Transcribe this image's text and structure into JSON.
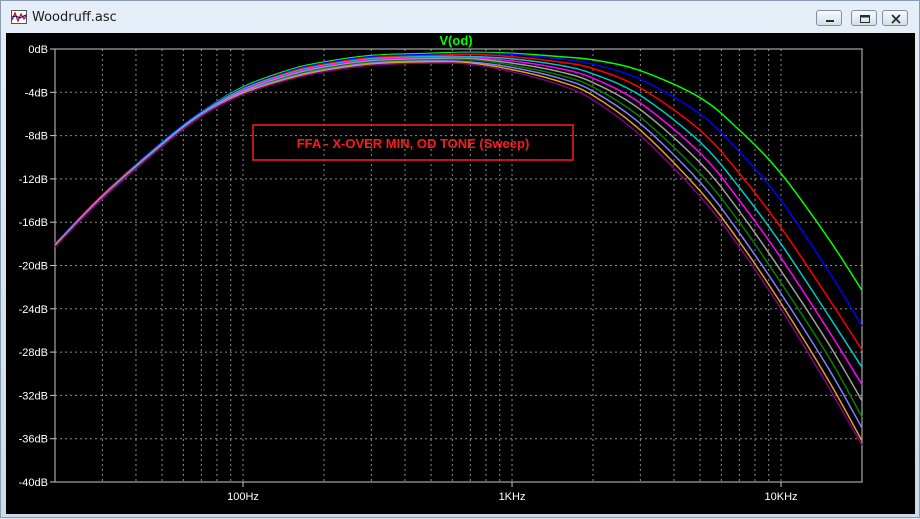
{
  "window": {
    "title": "Woodruff.asc",
    "icon": "ltspice-waveform-icon",
    "controls": [
      "minimize-icon",
      "restore-icon",
      "close-icon"
    ]
  },
  "colors": {
    "background": "#000000",
    "grid": "#8c8c8c",
    "axis": "#c8c8c8",
    "title": "#00ff00",
    "annotation": "#ff1a1a"
  },
  "chart_data": {
    "type": "line",
    "title": "V(od)",
    "annotation": "FFA - X-OVER MIN, OD TONE (Sweep)",
    "xscale": "log",
    "xlim": [
      20,
      20000
    ],
    "ylim": [
      -40,
      0
    ],
    "grid": true,
    "x_ticks": [
      {
        "value": 100,
        "label": "100Hz"
      },
      {
        "value": 1000,
        "label": "1KHz"
      },
      {
        "value": 10000,
        "label": "10KHz"
      }
    ],
    "y_ticks": [
      {
        "value": 0,
        "label": "0dB"
      },
      {
        "value": -4,
        "label": "-4dB"
      },
      {
        "value": -8,
        "label": "-8dB"
      },
      {
        "value": -12,
        "label": "-12dB"
      },
      {
        "value": -16,
        "label": "-16dB"
      },
      {
        "value": -20,
        "label": "-20dB"
      },
      {
        "value": -24,
        "label": "-24dB"
      },
      {
        "value": -28,
        "label": "-28dB"
      },
      {
        "value": -32,
        "label": "-32dB"
      },
      {
        "value": -36,
        "label": "-36dB"
      },
      {
        "value": -40,
        "label": "-40dB"
      }
    ],
    "x": [
      20,
      30,
      50,
      70,
      100,
      150,
      200,
      300,
      500,
      700,
      1000,
      1500,
      2000,
      3000,
      5000,
      7000,
      10000,
      15000,
      20000
    ],
    "series": [
      {
        "color": "#00ff00",
        "values": [
          -18.0,
          -13.5,
          -8.6,
          -5.8,
          -3.5,
          -1.9,
          -1.2,
          -0.6,
          -0.4,
          -0.3,
          -0.4,
          -0.7,
          -1.0,
          -2.0,
          -4.5,
          -7.5,
          -11.5,
          -17.5,
          -22.3
        ]
      },
      {
        "color": "#0000ff",
        "values": [
          -18.0,
          -13.5,
          -8.6,
          -5.8,
          -3.6,
          -2.0,
          -1.3,
          -0.7,
          -0.5,
          -0.4,
          -0.5,
          -0.9,
          -1.4,
          -2.8,
          -6.0,
          -9.5,
          -14.0,
          -20.5,
          -25.6
        ]
      },
      {
        "color": "#ff0000",
        "values": [
          -18.1,
          -13.5,
          -8.7,
          -5.9,
          -3.7,
          -2.1,
          -1.4,
          -0.8,
          -0.6,
          -0.5,
          -0.7,
          -1.2,
          -1.8,
          -3.6,
          -7.5,
          -11.5,
          -16.5,
          -23.0,
          -27.8
        ]
      },
      {
        "color": "#00c8c8",
        "values": [
          -18.1,
          -13.6,
          -8.7,
          -5.9,
          -3.7,
          -2.2,
          -1.5,
          -0.9,
          -0.7,
          -0.7,
          -0.9,
          -1.5,
          -2.3,
          -4.3,
          -8.6,
          -12.8,
          -18.0,
          -24.6,
          -29.4
        ]
      },
      {
        "color": "#ff00ff",
        "values": [
          -18.1,
          -13.6,
          -8.8,
          -6.0,
          -3.8,
          -2.3,
          -1.6,
          -1.0,
          -0.8,
          -0.8,
          -1.1,
          -1.8,
          -2.7,
          -5.0,
          -9.6,
          -14.0,
          -19.3,
          -26.0,
          -31.0
        ]
      },
      {
        "color": "#a0a0a0",
        "values": [
          -18.1,
          -13.6,
          -8.8,
          -6.0,
          -3.9,
          -2.4,
          -1.7,
          -1.1,
          -0.9,
          -0.9,
          -1.3,
          -2.1,
          -3.1,
          -5.6,
          -10.5,
          -15.0,
          -20.5,
          -27.2,
          -32.5
        ]
      },
      {
        "color": "#008000",
        "values": [
          -18.2,
          -13.7,
          -8.9,
          -6.1,
          -4.0,
          -2.5,
          -1.8,
          -1.2,
          -1.0,
          -1.0,
          -1.5,
          -2.4,
          -3.5,
          -6.3,
          -11.5,
          -16.0,
          -21.6,
          -28.4,
          -34.0
        ]
      },
      {
        "color": "#8080ff",
        "values": [
          -18.2,
          -13.7,
          -8.9,
          -6.1,
          -4.0,
          -2.6,
          -1.9,
          -1.3,
          -1.1,
          -1.2,
          -1.7,
          -2.7,
          -3.9,
          -6.9,
          -12.3,
          -17.0,
          -22.6,
          -29.5,
          -35.0
        ]
      },
      {
        "color": "#e0a020",
        "values": [
          -18.2,
          -13.8,
          -9.0,
          -6.2,
          -4.1,
          -2.7,
          -2.0,
          -1.4,
          -1.2,
          -1.3,
          -1.9,
          -3.0,
          -4.3,
          -7.5,
          -13.1,
          -17.8,
          -23.5,
          -30.6,
          -36.2
        ]
      },
      {
        "color": "#800080",
        "values": [
          -18.3,
          -13.8,
          -9.0,
          -6.2,
          -4.2,
          -2.8,
          -2.1,
          -1.5,
          -1.3,
          -1.4,
          -2.1,
          -3.3,
          -4.7,
          -8.0,
          -13.6,
          -18.3,
          -24.0,
          -31.2,
          -36.6
        ]
      }
    ]
  }
}
